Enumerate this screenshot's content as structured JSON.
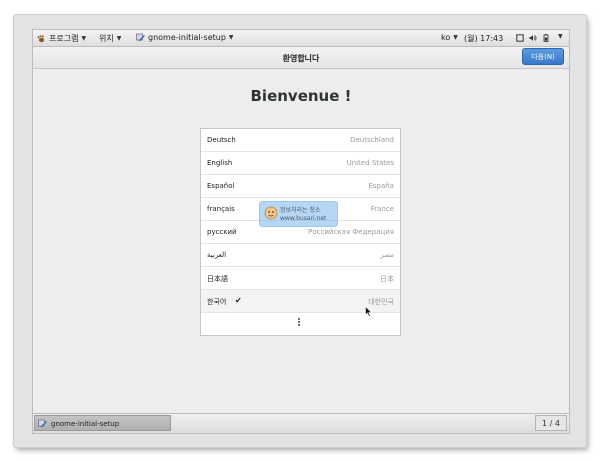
{
  "top_panel": {
    "applications_label": "프로그램",
    "places_label": "위치",
    "app_name": "gnome-initial-setup",
    "keyboard_layout": "ko",
    "clock": "(월) 17:43"
  },
  "header": {
    "title": "환영합니다",
    "next_button_label": "다음(N)"
  },
  "main": {
    "heading": "Bienvenue !",
    "languages": [
      {
        "name": "Deutsch",
        "region": "Deutschland",
        "selected": false
      },
      {
        "name": "English",
        "region": "United States",
        "selected": false
      },
      {
        "name": "Español",
        "region": "España",
        "selected": false
      },
      {
        "name": "français",
        "region": "France",
        "selected": false
      },
      {
        "name": "русский",
        "region": "Российская Федерация",
        "selected": false
      },
      {
        "name": "العربية",
        "region": "مصر",
        "selected": false
      },
      {
        "name": "日本語",
        "region": "日本",
        "selected": false
      },
      {
        "name": "한국어",
        "region": "대한민국",
        "selected": true
      }
    ],
    "more_icon": "vertical-ellipsis-icon"
  },
  "watermark": {
    "title": "정보처리는 청소",
    "url": "www.busari.net"
  },
  "bottom_panel": {
    "taskbar_label": "gnome-initial-setup",
    "workspace": "1 / 4"
  },
  "colors": {
    "accent": "#3778c9",
    "panel": "#e6e6e6",
    "background": "#ededed"
  }
}
